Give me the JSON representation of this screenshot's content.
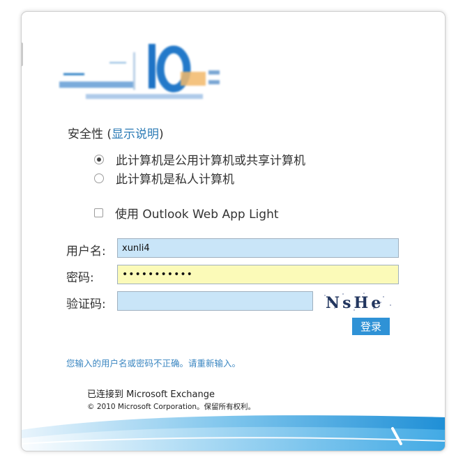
{
  "security": {
    "label": "安全性 (",
    "link": "显示说明",
    "close": ")"
  },
  "options": {
    "public_computer": "此计算机是公用计算机或共享计算机",
    "private_computer": "此计算机是私人计算机",
    "owa_light": "使用 Outlook Web App Light"
  },
  "form": {
    "username_label": "用户名:",
    "username_value": "xunli4",
    "password_label": "密码:",
    "password_value": "•••••••••••",
    "captcha_label": "验证码:",
    "captcha_value": "",
    "captcha_text": "NsHe",
    "login_button": "登录"
  },
  "messages": {
    "error": "您输入的用户名或密码不正确。请重新输入。",
    "connected": "已连接到 Microsoft Exchange",
    "copyright": "© 2010 Microsoft Corporation。保留所有权利。"
  },
  "colors": {
    "link": "#2a7ab5",
    "username_bg": "#c9e5f8",
    "password_bg": "#fbfab8",
    "button_bg": "#2f92d6"
  }
}
